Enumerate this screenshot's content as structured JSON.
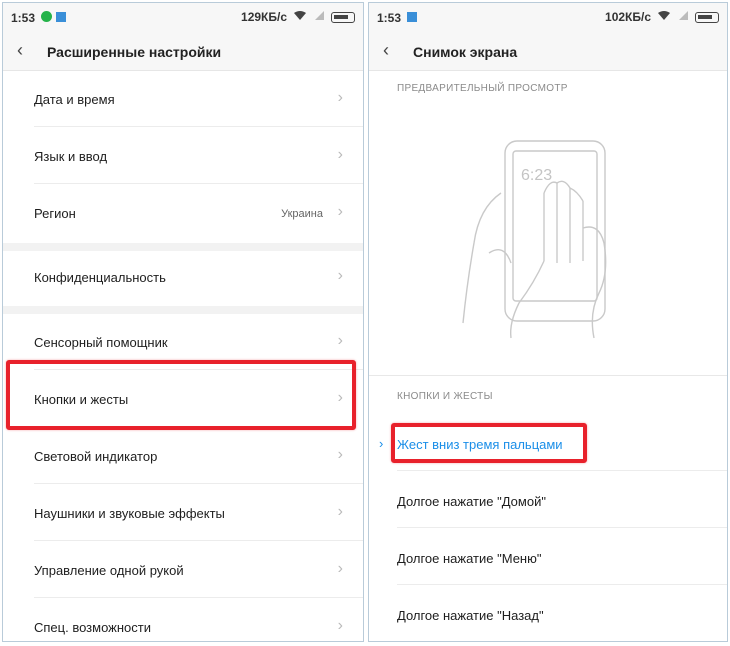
{
  "left": {
    "status": {
      "time": "1:53",
      "speed": "129КБ/с"
    },
    "title": "Расширенные настройки",
    "items": [
      {
        "label": "Дата и время",
        "value": ""
      },
      {
        "label": "Язык и ввод",
        "value": ""
      },
      {
        "label": "Регион",
        "value": "Украина"
      },
      {
        "label": "Конфиденциальность",
        "value": ""
      },
      {
        "label": "Сенсорный помощник",
        "value": ""
      },
      {
        "label": "Кнопки и жесты",
        "value": "",
        "highlighted": true
      },
      {
        "label": "Световой индикатор",
        "value": ""
      },
      {
        "label": "Наушники и звуковые эффекты",
        "value": ""
      },
      {
        "label": "Управление одной рукой",
        "value": ""
      },
      {
        "label": "Спец. возможности",
        "value": ""
      }
    ]
  },
  "right": {
    "status": {
      "time": "1:53",
      "speed": "102КБ/с"
    },
    "title": "Снимок экрана",
    "preview_header": "ПРЕДВАРИТЕЛЬНЫЙ ПРОСМОТР",
    "preview_time": "6:23",
    "section_header": "КНОПКИ И ЖЕСТЫ",
    "items": [
      {
        "label": "Жест вниз тремя пальцами",
        "active": true
      },
      {
        "label": "Долгое нажатие \"Домой\""
      },
      {
        "label": "Долгое нажатие \"Меню\""
      },
      {
        "label": "Долгое нажатие \"Назад\""
      }
    ]
  },
  "colors": {
    "highlight": "#e8212b",
    "accent": "#1a8ee8"
  }
}
